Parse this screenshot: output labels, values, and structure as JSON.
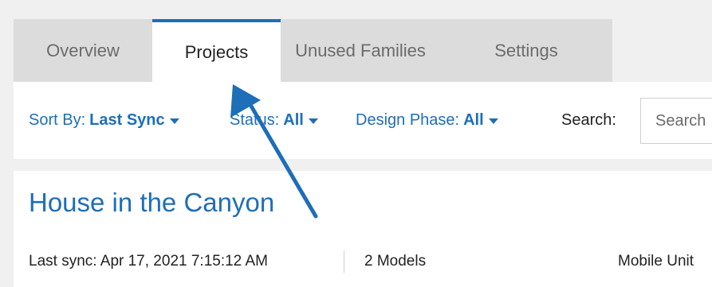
{
  "tabs": [
    {
      "label": "Overview"
    },
    {
      "label": "Projects"
    },
    {
      "label": "Unused Families"
    },
    {
      "label": "Settings"
    }
  ],
  "filters": {
    "sort": {
      "label": "Sort By:",
      "value": "Last Sync"
    },
    "status": {
      "label": "Status:",
      "value": "All"
    },
    "design_phase": {
      "label": "Design Phase:",
      "value": "All"
    }
  },
  "search": {
    "label": "Search:",
    "placeholder": "Search"
  },
  "project": {
    "title": "House in the Canyon",
    "last_sync": "Last sync: Apr 17, 2021 7:15:12 AM",
    "models": "2 Models",
    "team": "Mobile Unit"
  },
  "colors": {
    "accent": "#1e6eb8",
    "tabbar_bg": "#dcdcdc",
    "page_bg": "#f0f0f0"
  }
}
